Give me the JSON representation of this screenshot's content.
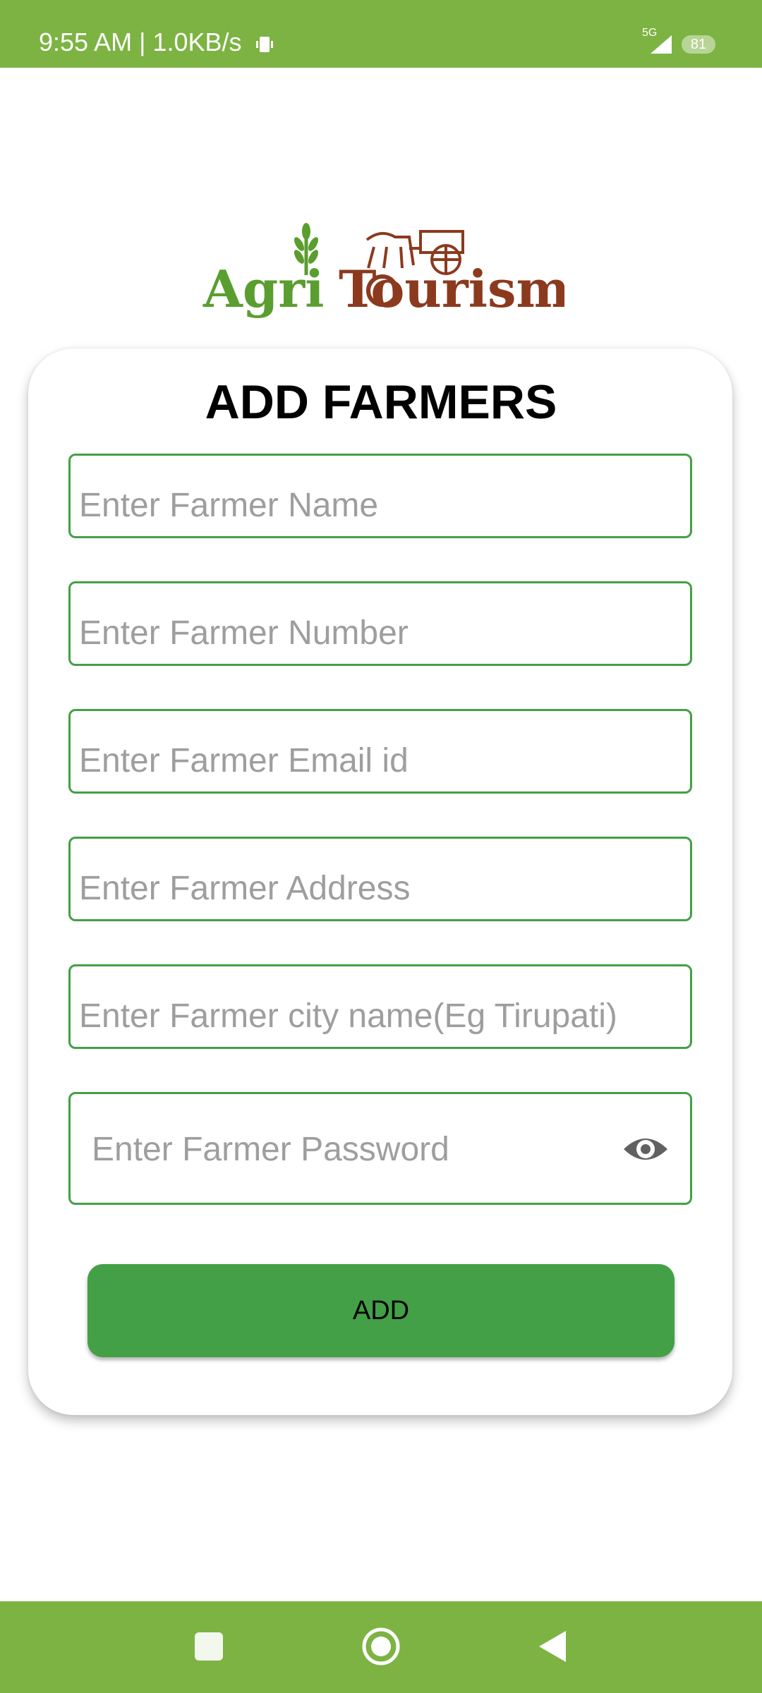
{
  "status": {
    "time": "9:55 AM | 1.0KB/s",
    "network": "5G",
    "battery": "81"
  },
  "logo": {
    "word1": "Agri",
    "word2": "Tourism"
  },
  "form": {
    "title": "ADD FARMERS",
    "name_placeholder": "Enter Farmer Name",
    "number_placeholder": "Enter Farmer Number",
    "email_placeholder": "Enter Farmer Email id",
    "address_placeholder": "Enter Farmer Address",
    "city_placeholder": "Enter Farmer city name(Eg Tirupati)",
    "password_placeholder": "Enter Farmer Password",
    "add_label": "ADD"
  },
  "icons": {
    "eye": "visibility-toggle-icon",
    "recents": "nav-recents-icon",
    "home": "nav-home-icon",
    "back": "nav-back-icon"
  },
  "colors": {
    "brand_green": "#7cb342",
    "accent_green": "#43a047",
    "logo_green": "#5a9e2f",
    "logo_brown": "#8b3a1e"
  }
}
